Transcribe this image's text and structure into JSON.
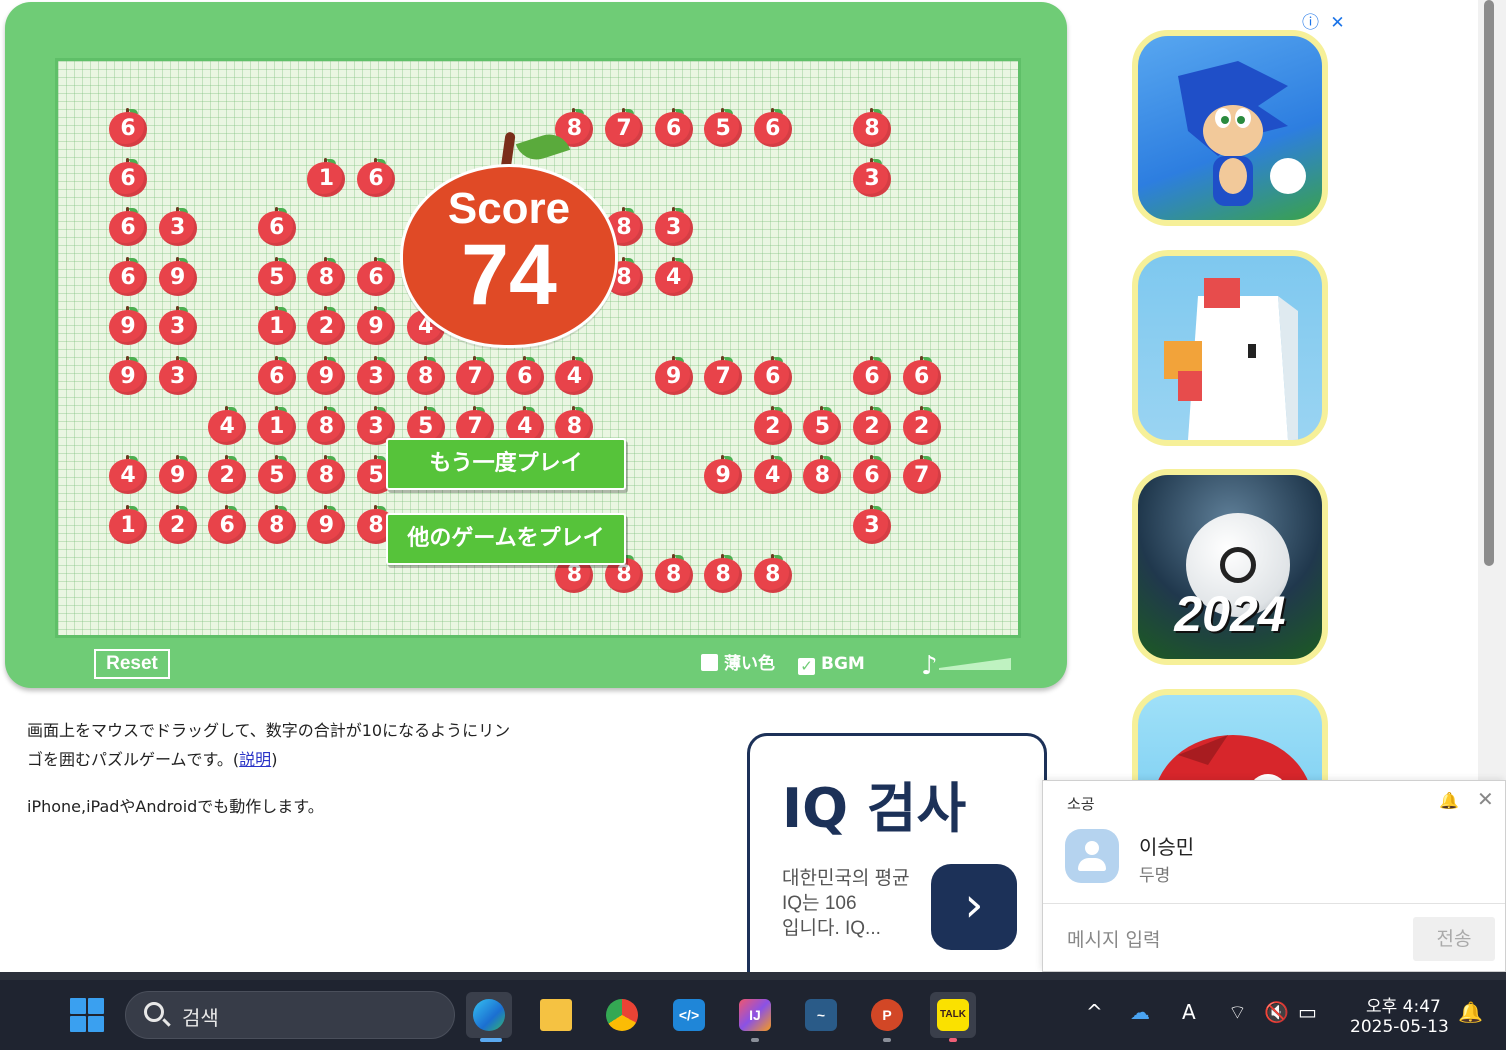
{
  "game": {
    "score_label": "Score",
    "score_value": "74",
    "play_again_label": "もう一度プレイ",
    "other_games_label": "他のゲームをプレイ",
    "reset_label": "Reset",
    "option_light_color": "薄い色",
    "option_bgm": "BGM",
    "option_light_color_checked": false,
    "option_bgm_checked": true,
    "apples": [
      {
        "c": 1,
        "r": 1,
        "n": "6"
      },
      {
        "c": 10,
        "r": 1,
        "n": "8"
      },
      {
        "c": 11,
        "r": 1,
        "n": "7"
      },
      {
        "c": 12,
        "r": 1,
        "n": "6"
      },
      {
        "c": 13,
        "r": 1,
        "n": "5"
      },
      {
        "c": 14,
        "r": 1,
        "n": "6"
      },
      {
        "c": 16,
        "r": 1,
        "n": "8"
      },
      {
        "c": 1,
        "r": 2,
        "n": "6"
      },
      {
        "c": 5,
        "r": 2,
        "n": "1"
      },
      {
        "c": 6,
        "r": 2,
        "n": "6"
      },
      {
        "c": 16,
        "r": 2,
        "n": "3"
      },
      {
        "c": 1,
        "r": 3,
        "n": "6"
      },
      {
        "c": 2,
        "r": 3,
        "n": "3"
      },
      {
        "c": 4,
        "r": 3,
        "n": "6"
      },
      {
        "c": 11,
        "r": 3,
        "n": "8"
      },
      {
        "c": 12,
        "r": 3,
        "n": "3"
      },
      {
        "c": 1,
        "r": 4,
        "n": "6"
      },
      {
        "c": 2,
        "r": 4,
        "n": "9"
      },
      {
        "c": 4,
        "r": 4,
        "n": "5"
      },
      {
        "c": 5,
        "r": 4,
        "n": "8"
      },
      {
        "c": 6,
        "r": 4,
        "n": "6"
      },
      {
        "c": 11,
        "r": 4,
        "n": "8"
      },
      {
        "c": 12,
        "r": 4,
        "n": "4"
      },
      {
        "c": 1,
        "r": 5,
        "n": "9"
      },
      {
        "c": 2,
        "r": 5,
        "n": "3"
      },
      {
        "c": 4,
        "r": 5,
        "n": "1"
      },
      {
        "c": 5,
        "r": 5,
        "n": "2"
      },
      {
        "c": 6,
        "r": 5,
        "n": "9"
      },
      {
        "c": 7,
        "r": 5,
        "n": "4"
      },
      {
        "c": 1,
        "r": 6,
        "n": "9"
      },
      {
        "c": 2,
        "r": 6,
        "n": "3"
      },
      {
        "c": 4,
        "r": 6,
        "n": "6"
      },
      {
        "c": 5,
        "r": 6,
        "n": "9"
      },
      {
        "c": 6,
        "r": 6,
        "n": "3"
      },
      {
        "c": 7,
        "r": 6,
        "n": "8"
      },
      {
        "c": 8,
        "r": 6,
        "n": "7"
      },
      {
        "c": 9,
        "r": 6,
        "n": "6"
      },
      {
        "c": 10,
        "r": 6,
        "n": "4"
      },
      {
        "c": 12,
        "r": 6,
        "n": "9"
      },
      {
        "c": 13,
        "r": 6,
        "n": "7"
      },
      {
        "c": 14,
        "r": 6,
        "n": "6"
      },
      {
        "c": 16,
        "r": 6,
        "n": "6"
      },
      {
        "c": 17,
        "r": 6,
        "n": "6"
      },
      {
        "c": 3,
        "r": 7,
        "n": "4"
      },
      {
        "c": 4,
        "r": 7,
        "n": "1"
      },
      {
        "c": 5,
        "r": 7,
        "n": "8"
      },
      {
        "c": 6,
        "r": 7,
        "n": "3"
      },
      {
        "c": 7,
        "r": 7,
        "n": "5"
      },
      {
        "c": 8,
        "r": 7,
        "n": "7"
      },
      {
        "c": 9,
        "r": 7,
        "n": "4"
      },
      {
        "c": 10,
        "r": 7,
        "n": "8"
      },
      {
        "c": 14,
        "r": 7,
        "n": "2"
      },
      {
        "c": 15,
        "r": 7,
        "n": "5"
      },
      {
        "c": 16,
        "r": 7,
        "n": "2"
      },
      {
        "c": 17,
        "r": 7,
        "n": "2"
      },
      {
        "c": 1,
        "r": 8,
        "n": "4"
      },
      {
        "c": 2,
        "r": 8,
        "n": "9"
      },
      {
        "c": 3,
        "r": 8,
        "n": "2"
      },
      {
        "c": 4,
        "r": 8,
        "n": "5"
      },
      {
        "c": 5,
        "r": 8,
        "n": "8"
      },
      {
        "c": 6,
        "r": 8,
        "n": "5"
      },
      {
        "c": 13,
        "r": 8,
        "n": "9"
      },
      {
        "c": 14,
        "r": 8,
        "n": "4"
      },
      {
        "c": 15,
        "r": 8,
        "n": "8"
      },
      {
        "c": 16,
        "r": 8,
        "n": "6"
      },
      {
        "c": 17,
        "r": 8,
        "n": "7"
      },
      {
        "c": 1,
        "r": 9,
        "n": "1"
      },
      {
        "c": 2,
        "r": 9,
        "n": "2"
      },
      {
        "c": 3,
        "r": 9,
        "n": "6"
      },
      {
        "c": 4,
        "r": 9,
        "n": "8"
      },
      {
        "c": 5,
        "r": 9,
        "n": "9"
      },
      {
        "c": 6,
        "r": 9,
        "n": "8"
      },
      {
        "c": 16,
        "r": 9,
        "n": "3"
      },
      {
        "c": 10,
        "r": 10,
        "n": "8"
      },
      {
        "c": 11,
        "r": 10,
        "n": "8"
      },
      {
        "c": 12,
        "r": 10,
        "n": "8"
      },
      {
        "c": 13,
        "r": 10,
        "n": "8"
      },
      {
        "c": 14,
        "r": 10,
        "n": "8"
      }
    ]
  },
  "description": {
    "line1": "画面上をマウスでドラッグして、数字の合計が10になるようにリン",
    "line2_prefix": "ゴを囲むパズルゲームです。(",
    "line2_link": "説明",
    "line2_suffix": ")",
    "line3": "iPhone,iPadやAndroidでも動作します。"
  },
  "iq_ad": {
    "title": "IQ 검사",
    "text_line1": "대한민국의 평균",
    "text_line2": "IQ는 106",
    "text_line3": "입니다. IQ..."
  },
  "right_ad": {
    "info_icon": "ⓘ",
    "close_icon": "✕",
    "soccer_year": "2024"
  },
  "chat": {
    "title": "소공",
    "contact_name": "이승민",
    "contact_sub": "두명",
    "input_placeholder": "메시지 입력",
    "send_label": "전송"
  },
  "taskbar": {
    "search_placeholder": "검색",
    "time": "오후 4:47",
    "date": "2025-05-13"
  },
  "colors": {
    "board_green": "#6fcc76",
    "apple_red": "#e8434a",
    "score_red": "#e04a26",
    "button_green": "#56c33a",
    "iq_navy": "#1c3158",
    "taskbar_bg": "#1f2430"
  }
}
